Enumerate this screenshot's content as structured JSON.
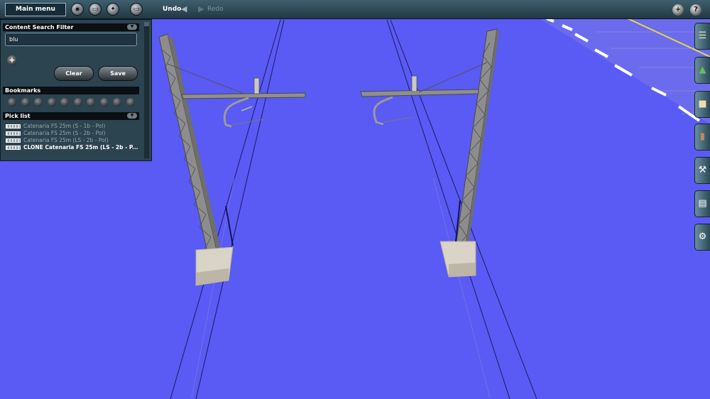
{
  "toolbar": {
    "main_menu_label": "Main menu",
    "undo_label": "Undo",
    "redo_label": "Redo",
    "right_buttons": [
      "+",
      "?"
    ]
  },
  "panel": {
    "search_filter_header": "Content Search Filter",
    "search_value": "blu",
    "clear_label": "Clear",
    "save_label": "Save",
    "bookmarks_header": "Bookmarks",
    "pick_list_header": "Pick list",
    "pick_list": [
      "Catenaria FS 25m (S - 1b - Pol)",
      "Catenaria FS 25m (S - 2b - Pol)",
      "Catenaria FS 25m (LS - 2b - Pol)",
      "CLONE Catenaria FS 25m (LS - 2b - P..."
    ]
  },
  "icons": {
    "toolbar": [
      "globe-icon",
      "trash-icon",
      "steering-wheel-icon",
      "trash-icon"
    ],
    "side_tabs": [
      "rail-track-icon",
      "tree-icon",
      "building-icon",
      "rolling-stock-icon",
      "wrench-icon",
      "layers-icon",
      "settings-icon"
    ]
  },
  "colors": {
    "sky": "#5a5af5",
    "toolbar": "#2e4a58",
    "panel": "#2c4350",
    "accent_text": "#ffffff"
  }
}
